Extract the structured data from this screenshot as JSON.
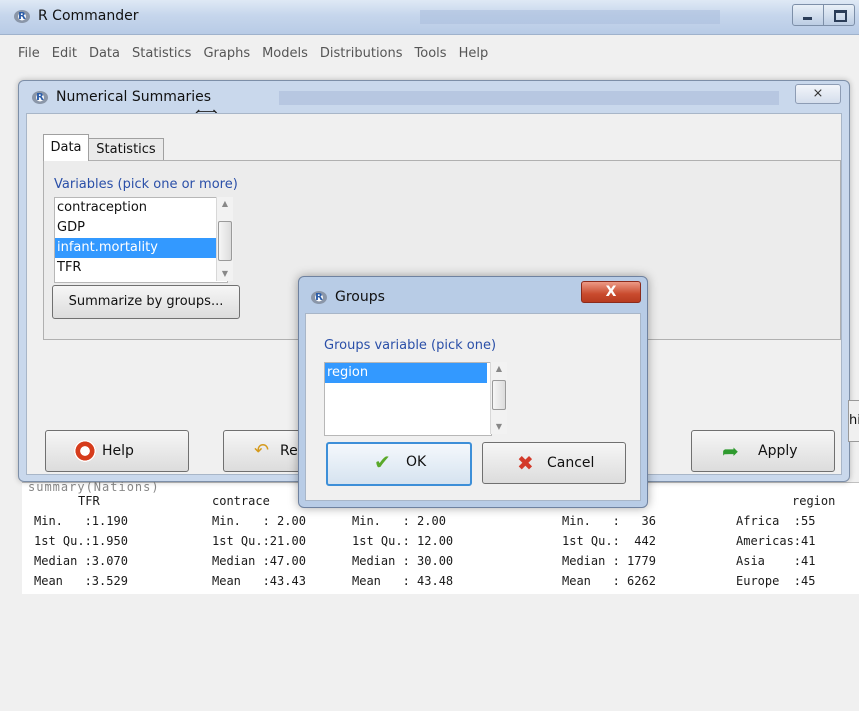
{
  "app": {
    "title": "R Commander",
    "menu": [
      "File",
      "Edit",
      "Data",
      "Statistics",
      "Graphs",
      "Models",
      "Distributions",
      "Tools",
      "Help"
    ]
  },
  "numerical_summaries": {
    "title": "Numerical Summaries",
    "tabs": [
      "Data",
      "Statistics"
    ],
    "variables_label": "Variables (pick one or more)",
    "variables": [
      "contraception",
      "GDP",
      "infant.mortality",
      "TFR"
    ],
    "selected_variable": "infant.mortality",
    "summarize_button": "Summarize by groups...",
    "help_button": "Help",
    "reset_button": "Re",
    "apply_button": "Apply",
    "close_glyph": "⨯",
    "right_stub": "hi"
  },
  "groups": {
    "title": "Groups",
    "close_glyph": "X",
    "label": "Groups variable (pick one)",
    "items": [
      "region"
    ],
    "selected": "region",
    "ok_button": "OK",
    "cancel_button": "Cancel"
  },
  "output": {
    "header_cut": "  summary(Nations)",
    "header": [
      "TFR",
      "contrace",
      "region"
    ],
    "rows": [
      [
        "Min.   :1.190",
        "Min.   : 2.00",
        "Min.   : 2.00",
        "Min.   :   36",
        "Africa  :55"
      ],
      [
        "1st Qu.:1.950",
        "1st Qu.:21.00",
        "1st Qu.: 12.00",
        "1st Qu.:  442",
        "Americas:41"
      ],
      [
        "Median :3.070",
        "Median :47.00",
        "Median : 30.00",
        "Median : 1779",
        "Asia    :41"
      ],
      [
        "Mean   :3.529",
        "Mean   :43.43",
        "Mean   : 43.48",
        "Mean   : 6262",
        "Europe  :45"
      ]
    ]
  },
  "icons": {
    "app_logo": "R",
    "resize": "⟺",
    "reset": "↶",
    "apply": "➦",
    "check": "✔",
    "cross": "✖",
    "scroll_up": "▲",
    "scroll_down": "▼"
  }
}
